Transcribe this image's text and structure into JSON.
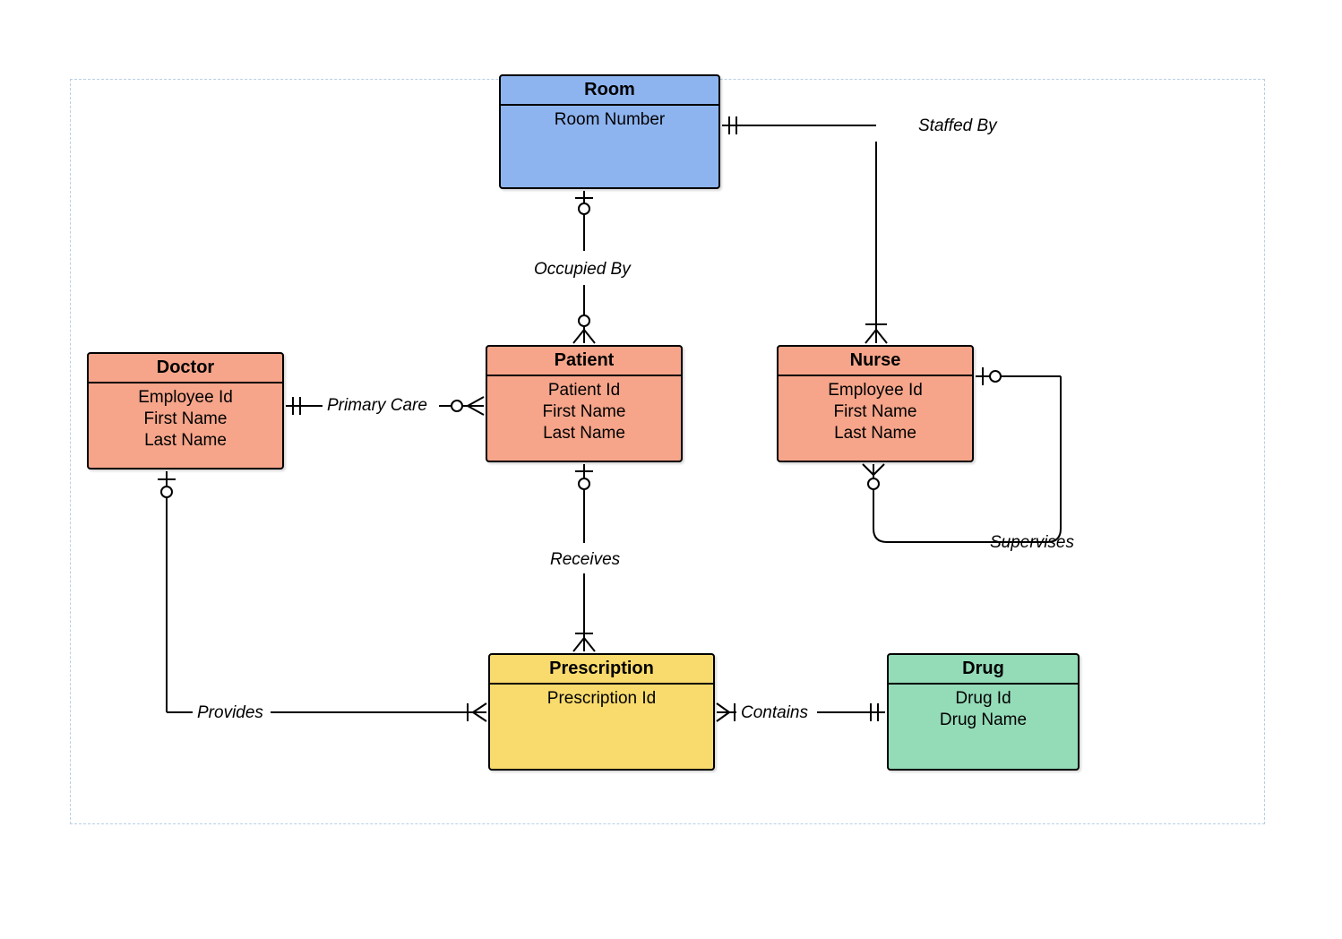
{
  "colors": {
    "blue": "#8eb4f0",
    "salmon": "#f6a58a",
    "yellow": "#f9db6d",
    "green": "#94dcb8"
  },
  "entities": {
    "room": {
      "title": "Room",
      "attributes": [
        "Room Number"
      ]
    },
    "doctor": {
      "title": "Doctor",
      "attributes": [
        "Employee Id",
        "First Name",
        "Last Name"
      ]
    },
    "patient": {
      "title": "Patient",
      "attributes": [
        "Patient Id",
        "First Name",
        "Last Name"
      ]
    },
    "nurse": {
      "title": "Nurse",
      "attributes": [
        "Employee Id",
        "First Name",
        "Last Name"
      ]
    },
    "prescription": {
      "title": "Prescription",
      "attributes": [
        "Prescription Id"
      ]
    },
    "drug": {
      "title": "Drug",
      "attributes": [
        "Drug Id",
        "Drug Name"
      ]
    }
  },
  "relationships": {
    "staffed_by": "Staffed By",
    "occupied_by": "Occupied By",
    "primary_care": "Primary Care",
    "receives": "Receives",
    "provides": "Provides",
    "contains": "Contains",
    "supervises": "Supervises"
  }
}
